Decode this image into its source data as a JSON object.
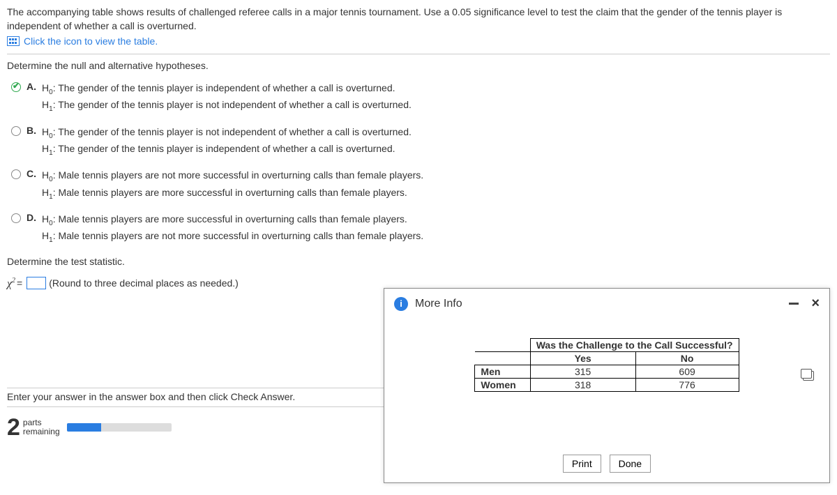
{
  "question": {
    "text": "The accompanying table shows results of challenged referee calls in a major tennis tournament. Use a 0.05 significance level to test the claim that the gender of the tennis player is independent of whether a call is overturned.",
    "table_link": "Click the icon to view the table."
  },
  "prompt1": "Determine the null and alternative hypotheses.",
  "options": {
    "A": {
      "h0": "The gender of the tennis player is independent of whether a call is overturned.",
      "h1": "The gender of the tennis player is not independent of whether a call is overturned."
    },
    "B": {
      "h0": "The gender of the tennis player is not independent of whether a call is overturned.",
      "h1": "The gender of the tennis player is independent of whether a call is overturned."
    },
    "C": {
      "h0": "Male tennis players are not more successful in overturning calls than female players.",
      "h1": "Male tennis players are more successful in overturning calls than female players."
    },
    "D": {
      "h0": "Male tennis players are more successful in overturning calls than female players.",
      "h1": "Male tennis players are not more successful in overturning calls than female players."
    }
  },
  "selected_option": "A",
  "prompt2": "Determine the test statistic.",
  "stat": {
    "symbol": "χ",
    "equals": "=",
    "value": "",
    "hint": "(Round to three decimal places as needed.)"
  },
  "footer": {
    "instruction": "Enter your answer in the answer box and then click Check Answer.",
    "parts_number": "2",
    "parts_label1": "parts",
    "parts_label2": "remaining"
  },
  "modal": {
    "title": "More Info",
    "group_header": "Was the Challenge to the Call Successful?",
    "col_yes": "Yes",
    "col_no": "No",
    "rows": [
      {
        "label": "Men",
        "yes": "315",
        "no": "609"
      },
      {
        "label": "Women",
        "yes": "318",
        "no": "776"
      }
    ],
    "print": "Print",
    "done": "Done"
  },
  "chart_data": {
    "type": "table",
    "title": "Was the Challenge to the Call Successful?",
    "columns": [
      "Yes",
      "No"
    ],
    "rows": [
      "Men",
      "Women"
    ],
    "values": [
      [
        315,
        609
      ],
      [
        318,
        776
      ]
    ]
  }
}
